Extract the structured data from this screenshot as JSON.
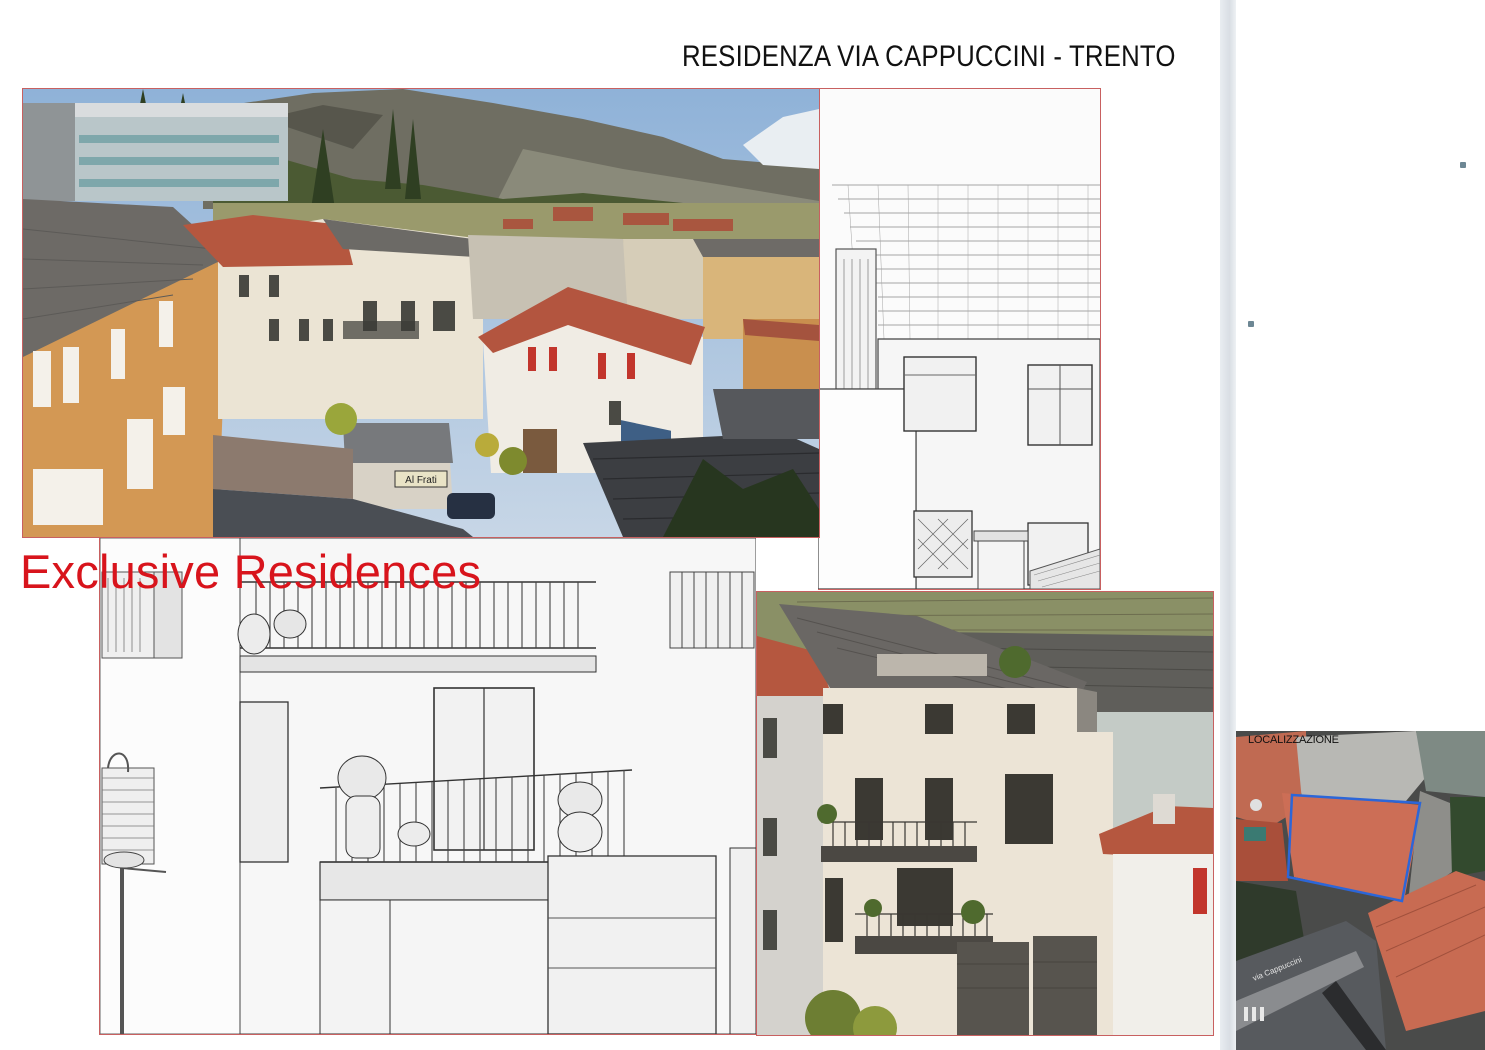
{
  "title": "RESIDENZA VIA CAPPUCCINI - TRENTO",
  "headline": "Exclusive Residences",
  "aerial": {
    "label": "LOCALIZZAZIONE",
    "street": "via Cappuccini"
  },
  "photo": {
    "shop_sign": "Al Frati"
  },
  "colors": {
    "headline": "#d8141c",
    "frame": "#c86060",
    "site_outline": "#2c66d8",
    "roof_tile": "#b5573f",
    "facade_cream": "#ece4d6",
    "facade_ochre": "#d29a55",
    "render_metal_roof": "#6a6764"
  }
}
